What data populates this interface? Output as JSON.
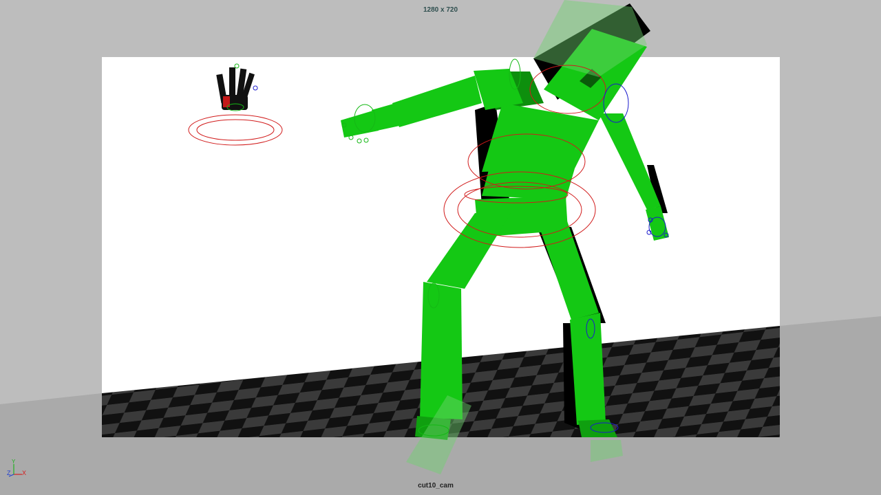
{
  "viewport": {
    "resolution_label": "1280 x 720",
    "camera_name": "cut10_cam",
    "background_color": "#bdbdbd",
    "gate_fill": "#ffffff"
  },
  "axis_gizmo": {
    "x_label": "X",
    "y_label": "Y",
    "z_label": "Z",
    "x_color": "#d42020",
    "y_color": "#20b020",
    "z_color": "#2040d0"
  },
  "character": {
    "body_color": "#14c814",
    "shadow_color": "#000000"
  },
  "controls": {
    "fk_color": "#d11a1a",
    "ik_left_color": "#1a1acc",
    "ik_right_color": "#14b814"
  }
}
